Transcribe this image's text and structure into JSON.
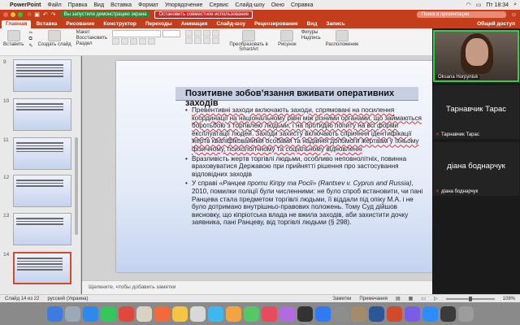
{
  "menubar": {
    "apple": "",
    "app": "PowerPoint",
    "items": [
      "Файл",
      "Правка",
      "Вид",
      "Вставка",
      "Формат",
      "Упорядочение",
      "Сервис",
      "Слайд-шоу",
      "Окно",
      "Справка"
    ],
    "clock": "Пт 18:34"
  },
  "titlebar": {
    "demo_notice": "Вы запустили демонстрацию экрана",
    "stop_sharing": "Остановить совместное использование",
    "search_placeholder": "Поиск в презентации"
  },
  "tabs": [
    "Главная",
    "Вставка",
    "Рисование",
    "Конструктор",
    "Переходы",
    "Анимация",
    "Слайд-шоу",
    "Рецензирование",
    "Вид",
    "Запись"
  ],
  "share_label": "Общий доступ",
  "ribbon": {
    "paste": "Вставить",
    "layout": "Макет",
    "reset": "Восстановить",
    "new_slide": "Создать слайд",
    "section": "Раздел",
    "convert_smartart": "Преобразовать в SmartArt",
    "picture": "Рисунок",
    "shapes": "Фигуры",
    "textbox": "Надпись",
    "arrange": "Расположение"
  },
  "thumbnails": [
    {
      "num": "9"
    },
    {
      "num": "10"
    },
    {
      "num": "11"
    },
    {
      "num": "12"
    },
    {
      "num": "13"
    },
    {
      "num": "14"
    }
  ],
  "slide": {
    "title": "Позитивне зобов’язання вживати оперативних заходів",
    "bullet1": "Превентивні заходи включають заходи, спрямовані на посилення координації на національному рівні між різними органами, що займаються боротьбою з торгівлею людьми, і на протидію попиту на всі форми експлуатації людей. Заходи захисту включають сприяння ідентифікації жертв кваліфікованими особами та надання допомоги жертвам у їхньому фізичному, психологічному та соціальному відновленні",
    "bullet2": "Вразливість жертв торгівлі людьми, особливо неповнолітніх, повинна враховуватися Державою при прийнятті рішення про застосування відповідних заходів",
    "bullet3_lead": "У справі ",
    "bullet3_case": "«Ранцев проти Кіпру та Росії»",
    "bullet3_en": " (Rantsev v. Cyprus and Russia)",
    "bullet3_rest": ", 2010, помилки поліції були численними: не було спроб встановити, чи пані Ранцева стала предметом торгівлі людьми, її віддали під опіку М.А. і не було дотримано внутрішньо-правових положень. Тому Суд дійшов висновку, що кіпріотська влада не вжила заходів, аби захистити дочку заявника, пані Ранцеву, від торгівлі людьми (§ 298)."
  },
  "notes_placeholder": "Щелкните, чтобы добавить заметки",
  "status": {
    "slide_info": "Слайд 14 из 22",
    "language": "русский (Украина)",
    "notes_btn": "Заметки",
    "comments_btn": "Примечания",
    "zoom": "108%"
  },
  "zoom_panel": {
    "video_name": "Oksana Horpyniuk",
    "p1_big": "Тарнавчик Тарас",
    "p1_small": "Тарнавчик Тарас",
    "p2_big": "діана боднарчук",
    "p2_small": "діана боднарчук"
  },
  "colors": {
    "accent": "#c43e1c",
    "active_speaker": "#2ad14c"
  }
}
